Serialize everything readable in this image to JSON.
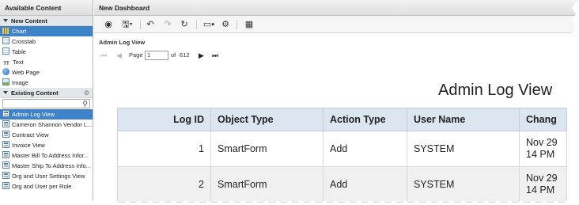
{
  "left_panel": {
    "title": "Available Content",
    "new_content": {
      "heading": "New Content",
      "items": [
        {
          "label": "Chart",
          "icon": "chart-icon",
          "selected": true
        },
        {
          "label": "Crosstab",
          "icon": "crosstab-icon"
        },
        {
          "label": "Table",
          "icon": "table-icon"
        },
        {
          "label": "Text",
          "icon": "text-icon"
        },
        {
          "label": "Web Page",
          "icon": "globe-icon"
        },
        {
          "label": "Image",
          "icon": "image-icon"
        }
      ]
    },
    "existing_content": {
      "heading": "Existing Content",
      "search_placeholder": "",
      "items": [
        {
          "label": "Admin Log View",
          "selected": true
        },
        {
          "label": "Cameron Shannon Vendor L..."
        },
        {
          "label": "Contract View"
        },
        {
          "label": "Invoice View"
        },
        {
          "label": "Master Bill To Address Infor..."
        },
        {
          "label": "Master Ship To Address Info..."
        },
        {
          "label": "Org and User Settings View"
        },
        {
          "label": "Org and User per Role"
        }
      ]
    }
  },
  "dashboard": {
    "title": "New Dashboard",
    "toolbar": [
      "view-icon",
      "save-icon",
      "undo-icon",
      "redo-icon",
      "refresh-icon",
      "layout-icon",
      "settings-icon",
      "grid-icon"
    ]
  },
  "report": {
    "name": "Admin Log View",
    "pager": {
      "page_label": "Page",
      "page_value": "1",
      "of_label": "of",
      "total_pages": "612"
    },
    "title": "Admin Log View",
    "columns": [
      "Log ID",
      "Object Type",
      "Action Type",
      "User Name",
      "Chang"
    ],
    "rows": [
      {
        "log_id": "1",
        "object_type": "SmartForm",
        "action_type": "Add",
        "user_name": "SYSTEM",
        "change_line1": "Nov 29",
        "change_line2": "14 PM"
      },
      {
        "log_id": "2",
        "object_type": "SmartForm",
        "action_type": "Add",
        "user_name": "SYSTEM",
        "change_line1": "Nov 29",
        "change_line2": "14 PM"
      }
    ]
  }
}
